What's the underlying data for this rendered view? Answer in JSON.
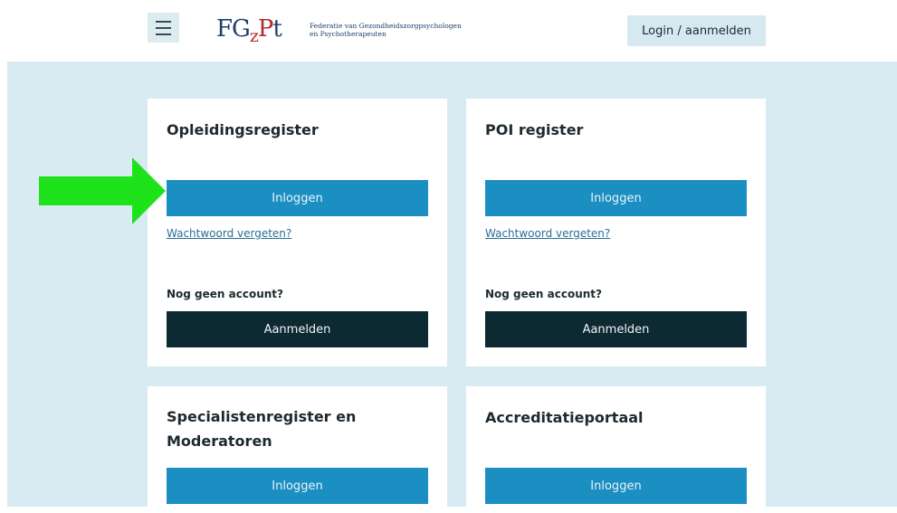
{
  "header": {
    "menu_icon": "hamburger-icon",
    "logo": {
      "mark_f": "F",
      "mark_g": "G",
      "mark_z": "z",
      "mark_p": "P",
      "mark_t": "t",
      "line1": "Federatie van Gezondheidszorgpsychologen",
      "line2": "en Psychotherapeuten"
    },
    "login_label": "Login / aanmelden"
  },
  "cards": [
    {
      "title": "Opleidingsregister",
      "login_label": "Inloggen",
      "forgot_label": "Wachtwoord vergeten?",
      "no_account_label": "Nog geen account?",
      "register_label": "Aanmelden"
    },
    {
      "title": "POI register",
      "login_label": "Inloggen",
      "forgot_label": "Wachtwoord vergeten?",
      "no_account_label": "Nog geen account?",
      "register_label": "Aanmelden"
    },
    {
      "title_line1": "Specialistenregister en",
      "title_line2": "Moderatoren",
      "login_label": "Inloggen"
    },
    {
      "title": "Accreditatieportaal",
      "login_label": "Inloggen"
    }
  ],
  "annotation": {
    "arrow_color": "#1ee31a",
    "arrow_icon": "right-arrow-icon"
  },
  "colors": {
    "page_bg": "#d9ebf2",
    "primary_button": "#1b8fc2",
    "dark_button": "#0d2a33",
    "link": "#2b6e94"
  }
}
